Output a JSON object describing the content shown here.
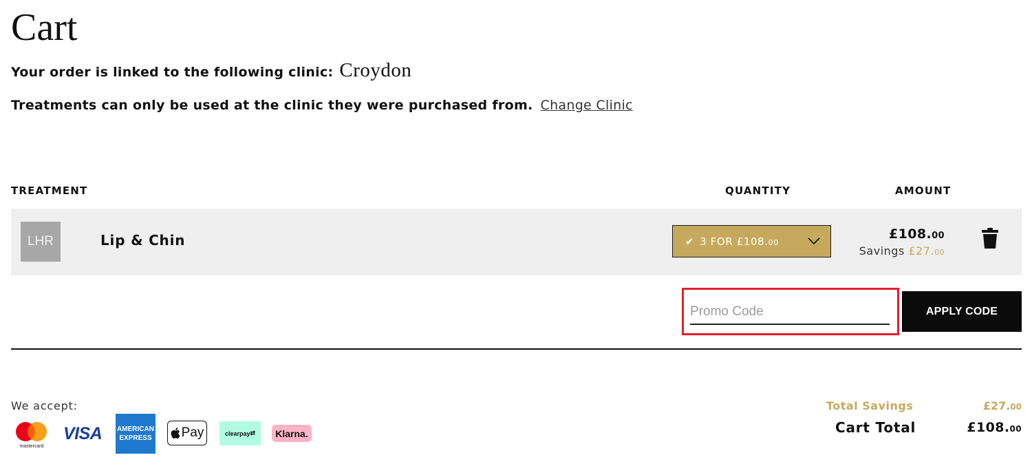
{
  "page": {
    "title": "Cart"
  },
  "clinic": {
    "linked_label": "Your order is linked to the following clinic:",
    "name": "Croydon",
    "notice": "Treatments can only be used at the clinic they were purchased from.",
    "change_link": "Change Clinic"
  },
  "table": {
    "headers": {
      "treatment": "TREATMENT",
      "quantity": "QUANTITY",
      "amount": "AMOUNT"
    },
    "items": [
      {
        "thumb_text": "LHR",
        "name": "Lip & Chin",
        "quantity_option": {
          "main": "3 FOR £108.",
          "pence": "00"
        },
        "price": {
          "main": "£108.",
          "pence": "00"
        },
        "savings_label": "Savings",
        "savings": {
          "main": "£27.",
          "pence": "00"
        }
      }
    ]
  },
  "promo": {
    "placeholder": "Promo Code",
    "value": "",
    "apply_label": "APPLY CODE"
  },
  "payments": {
    "label": "We accept:",
    "methods": [
      "mastercard",
      "VISA",
      "AMERICAN EXPRESS",
      "Pay",
      "clearpay",
      "Klarna."
    ],
    "mastercard_text": "mastercard",
    "visa_text": "VISA",
    "amex_line1": "AMERICAN",
    "amex_line2": "EXPRESS",
    "apple_text": "Pay",
    "clearpay_text": "clearpay",
    "klarna_text": "Klarna."
  },
  "totals": {
    "savings_label": "Total Savings",
    "savings": {
      "main": "£27.",
      "pence": "00"
    },
    "total_label": "Cart Total",
    "total": {
      "main": "£108.",
      "pence": "00"
    }
  },
  "colors": {
    "gold": "#c6a95c",
    "row_bg": "#efefef",
    "highlight": "#e0202a",
    "button": "#0b0b0b"
  },
  "icons": {
    "check": "check-icon",
    "chevron": "chevron-down-icon",
    "delete": "trash-icon"
  }
}
